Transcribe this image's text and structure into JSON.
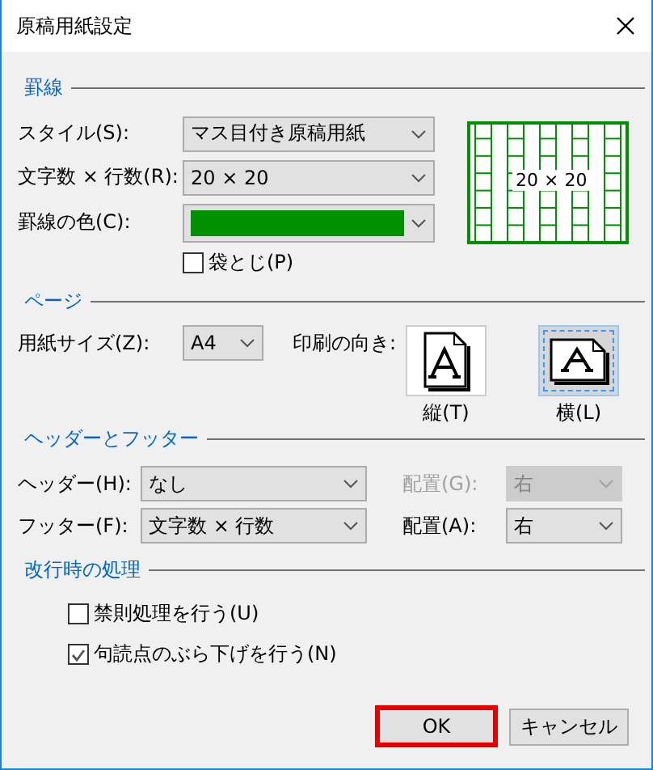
{
  "window": {
    "title": "原稿用紙設定"
  },
  "ruled_lines": {
    "heading": "罫線",
    "style": {
      "label": "スタイル(S):",
      "value": "マス目付き原稿用紙"
    },
    "grid_size": {
      "label": "文字数 × 行数(R):",
      "value": "20 × 20"
    },
    "line_color": {
      "label": "罫線の色(C):",
      "color": "#009000"
    },
    "binding": {
      "label": "袋とじ(P)",
      "checked": false
    },
    "preview": {
      "text": "20 × 20"
    }
  },
  "page": {
    "heading": "ページ",
    "paper_size": {
      "label": "用紙サイズ(Z):",
      "value": "A4"
    },
    "orientation": {
      "label": "印刷の向き:",
      "options": [
        {
          "label": "縦(T)",
          "kind": "portrait",
          "selected": false
        },
        {
          "label": "横(L)",
          "kind": "landscape",
          "selected": true
        }
      ]
    }
  },
  "header_footer": {
    "heading": "ヘッダーとフッター",
    "rows": [
      {
        "label": "ヘッダー(H):",
        "value": "なし",
        "align_label": "配置(G):",
        "align_value": "右",
        "align_disabled": true
      },
      {
        "label": "フッター(F):",
        "value": "文字数 × 行数",
        "align_label": "配置(A):",
        "align_value": "右",
        "align_disabled": false
      }
    ]
  },
  "line_break": {
    "heading": "改行時の処理",
    "options": [
      {
        "label": "禁則処理を行う(U)",
        "checked": false
      },
      {
        "label": "句読点のぶら下げを行う(N)",
        "checked": true
      }
    ]
  },
  "buttons": [
    {
      "label": "OK",
      "highlighted": true
    },
    {
      "label": "キャンセル",
      "highlighted": false
    }
  ]
}
